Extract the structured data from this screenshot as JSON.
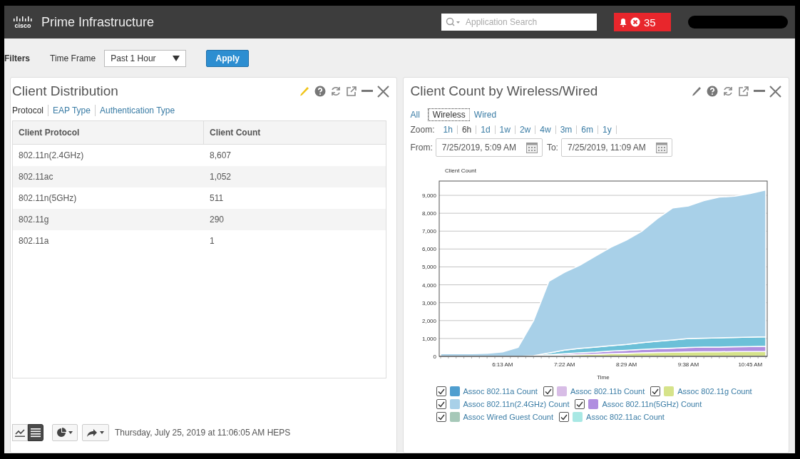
{
  "header": {
    "logo_text": "cisco",
    "product": "Prime Infrastructure",
    "search": {
      "placeholder": "Application Search"
    },
    "alarm_count": "35"
  },
  "filters": {
    "label": "Filters",
    "time_frame": {
      "label": "Time Frame",
      "value": "Past 1 Hour"
    },
    "apply": "Apply"
  },
  "client_distribution": {
    "title": "Client Distribution",
    "edit_active": true,
    "tabs": [
      {
        "label": "Protocol",
        "selected": true
      },
      {
        "label": "EAP Type",
        "selected": false
      },
      {
        "label": "Authentication Type",
        "selected": false
      }
    ],
    "table": {
      "columns": [
        "Client Protocol",
        "Client Count"
      ],
      "rows": [
        [
          "802.11n(2.4GHz)",
          "8,607"
        ],
        [
          "802.11ac",
          "1,052"
        ],
        [
          "802.11n(5GHz)",
          "511"
        ],
        [
          "802.11g",
          "290"
        ],
        [
          "802.11a",
          "1"
        ]
      ]
    },
    "footer": {
      "view_buttons": [
        {
          "kind": "chart",
          "selected": false
        },
        {
          "kind": "table",
          "selected": true
        }
      ],
      "timestamp": "Thursday, July 25, 2019 at 11:06:05 AM HEPS"
    }
  },
  "client_count": {
    "title": "Client Count by Wireless/Wired",
    "edit_active": false,
    "type_tabs": [
      {
        "label": "All",
        "selected": false
      },
      {
        "label": "Wireless",
        "selected": true
      },
      {
        "label": "Wired",
        "selected": false
      }
    ],
    "zoom": {
      "label": "Zoom:",
      "options": [
        {
          "label": "1h",
          "selected": false
        },
        {
          "label": "6h",
          "selected": true
        },
        {
          "label": "1d",
          "selected": false
        },
        {
          "label": "1w",
          "selected": false
        },
        {
          "label": "2w",
          "selected": false
        },
        {
          "label": "4w",
          "selected": false
        },
        {
          "label": "3m",
          "selected": false
        },
        {
          "label": "6m",
          "selected": false
        },
        {
          "label": "1y",
          "selected": false
        }
      ]
    },
    "from": {
      "label": "From:",
      "value": "7/25/2019, 5:09 AM"
    },
    "to": {
      "label": "To:",
      "value": "7/25/2019, 11:09 AM"
    },
    "chart_data": {
      "type": "area",
      "stacked": true,
      "ylabel": "Client Count",
      "xlabel": "Time",
      "categories": [
        null,
        null,
        null,
        null,
        "6:13 AM",
        null,
        null,
        null,
        "7:22 AM",
        null,
        null,
        null,
        "8:29 AM",
        null,
        null,
        null,
        "9:38 AM",
        null,
        null,
        null,
        "10:45 AM",
        null
      ],
      "ylim": [
        0,
        9800
      ],
      "grid": true,
      "yticks": [
        {
          "value": 0,
          "label": "0"
        },
        {
          "value": 1000,
          "label": "1,000"
        },
        {
          "value": 2000,
          "label": "2,000"
        },
        {
          "value": 3000,
          "label": "3,000"
        },
        {
          "value": 4000,
          "label": "4,000"
        },
        {
          "value": 5000,
          "label": "5,000"
        },
        {
          "value": 6000,
          "label": "6,000"
        },
        {
          "value": 7000,
          "label": "7,000"
        },
        {
          "value": 8000,
          "label": "8,000"
        },
        {
          "value": 9000,
          "label": "9,000"
        }
      ],
      "series": [
        {
          "color": "#d6e38a",
          "values": [
            0,
            0,
            0,
            0,
            0,
            0,
            10,
            40,
            70,
            100,
            120,
            150,
            170,
            200,
            220,
            230,
            250,
            260,
            260,
            270,
            270,
            280
          ]
        },
        {
          "color": "#b08ee0",
          "values": [
            0,
            0,
            0,
            0,
            0,
            0,
            10,
            50,
            80,
            100,
            120,
            150,
            170,
            190,
            210,
            230,
            250,
            260,
            260,
            270,
            280,
            290
          ]
        },
        {
          "color": "#6cc0d8",
          "values": [
            0,
            0,
            0,
            0,
            0,
            0,
            20,
            100,
            200,
            250,
            280,
            300,
            330,
            380,
            420,
            460,
            500,
            500,
            510,
            520,
            520,
            520
          ]
        },
        {
          "color": "#a8d0e8",
          "values": [
            150,
            150,
            150,
            170,
            250,
            500,
            1960,
            4010,
            4350,
            4650,
            5080,
            5500,
            5830,
            6230,
            6850,
            7380,
            7400,
            7680,
            7870,
            7890,
            8030,
            8210
          ]
        }
      ]
    },
    "legend": [
      {
        "label": "Assoc 802.11a Count",
        "checked": true,
        "color": "#4f9ecf"
      },
      {
        "label": "Assoc 802.11b Count",
        "checked": true,
        "color": "#d8bde6"
      },
      {
        "label": "Assoc 802.11g Count",
        "checked": true,
        "color": "#d6e38a"
      },
      {
        "label": "Assoc 802.11n(2.4GHz) Count",
        "checked": true,
        "color": "#a8d0e8"
      },
      {
        "label": "Assoc 802.11n(5GHz) Count",
        "checked": true,
        "color": "#b08ee0"
      },
      {
        "label": "Assoc Wired Guest Count",
        "checked": true,
        "color": "#a6c8b8"
      },
      {
        "label": "Assoc 802.11ac Count",
        "checked": true,
        "color": "#a8e8e4"
      }
    ]
  }
}
